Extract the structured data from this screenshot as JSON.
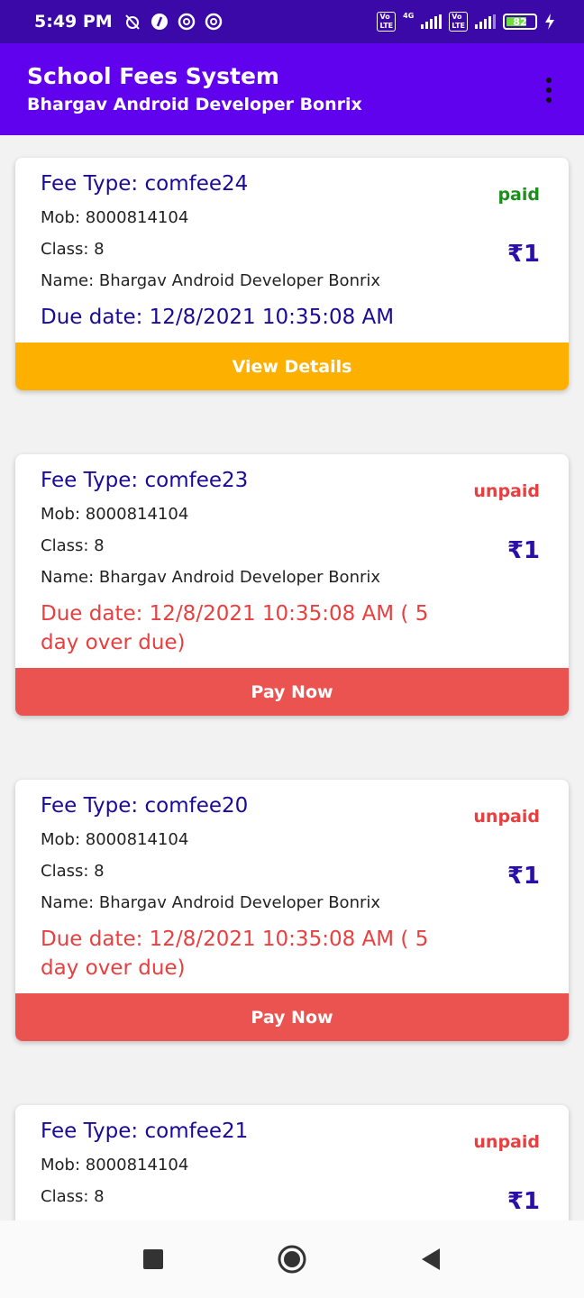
{
  "status_bar": {
    "time": "5:49 PM",
    "battery": "82",
    "network": "4G"
  },
  "app_bar": {
    "title": "School Fees System",
    "subtitle": "Bhargav Android Developer Bonrix"
  },
  "colors": {
    "status_bar": "#3b09a8",
    "app_bar": "#6002ee",
    "paid": "#1e8e1e",
    "unpaid": "#e84040",
    "overdue": "#e84040",
    "due": "#1a0b96",
    "view_button": "#fdb000",
    "pay_button": "#eb5350"
  },
  "cards": [
    {
      "fee_type": "Fee Type: comfee24",
      "mob": "Mob: 8000814104",
      "class": "Class: 8",
      "name": "Name: Bhargav Android Developer Bonrix",
      "due": "Due date: 12/8/2021 10:35:08 AM",
      "status": "paid",
      "amount": "₹1",
      "action": "View Details"
    },
    {
      "fee_type": "Fee Type: comfee23",
      "mob": "Mob: 8000814104",
      "class": "Class: 8",
      "name": "Name: Bhargav Android Developer Bonrix",
      "due": "Due date: 12/8/2021 10:35:08 AM ( 5 day over due)",
      "status": "unpaid",
      "amount": "₹1",
      "action": "Pay Now"
    },
    {
      "fee_type": "Fee Type: comfee20",
      "mob": "Mob: 8000814104",
      "class": "Class: 8",
      "name": "Name: Bhargav Android Developer Bonrix",
      "due": "Due date: 12/8/2021 10:35:08 AM ( 5 day over due)",
      "status": "unpaid",
      "amount": "₹1",
      "action": "Pay Now"
    },
    {
      "fee_type": "Fee Type: comfee21",
      "mob": "Mob: 8000814104",
      "class": "Class: 8",
      "status": "unpaid",
      "amount": "₹1"
    }
  ],
  "nav": {
    "recents_icon": "square-icon",
    "home_icon": "circle-icon",
    "back_icon": "triangle-back-icon"
  }
}
